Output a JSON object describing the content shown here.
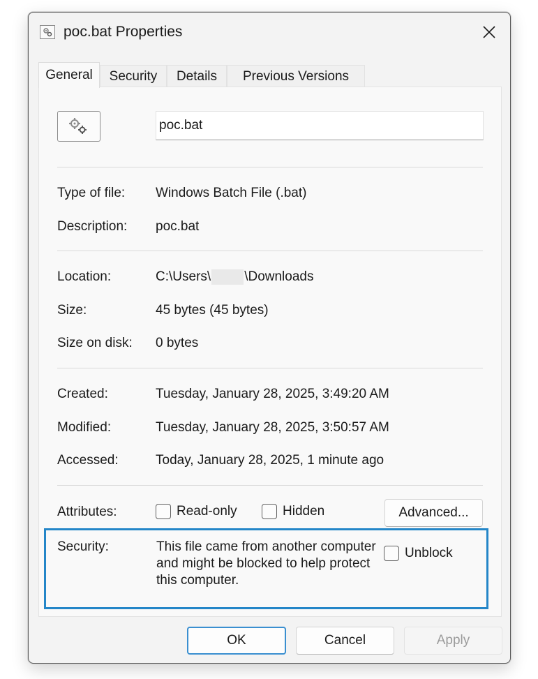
{
  "window": {
    "title": "poc.bat Properties",
    "title_icon": "bat-file-icon",
    "close_icon": "close-icon"
  },
  "tabs": [
    {
      "label": "General",
      "active": true
    },
    {
      "label": "Security",
      "active": false
    },
    {
      "label": "Details",
      "active": false
    },
    {
      "label": "Previous Versions",
      "active": false
    }
  ],
  "general": {
    "file_icon": "gears-icon",
    "file_name": "poc.bat",
    "type_of_file": {
      "label": "Type of file:",
      "value": "Windows Batch File (.bat)"
    },
    "description": {
      "label": "Description:",
      "value": "poc.bat"
    },
    "location": {
      "label": "Location:",
      "value_prefix": "C:\\Users\\",
      "value_suffix": "\\Downloads"
    },
    "size": {
      "label": "Size:",
      "value": "45 bytes (45 bytes)"
    },
    "size_on_disk": {
      "label": "Size on disk:",
      "value": "0 bytes"
    },
    "created": {
      "label": "Created:",
      "value": "Tuesday, January 28, 2025, 3:49:20 AM"
    },
    "modified": {
      "label": "Modified:",
      "value": "Tuesday, January 28, 2025, 3:50:57 AM"
    },
    "accessed": {
      "label": "Accessed:",
      "value": "Today, January 28, 2025, 1 minute ago"
    },
    "attributes": {
      "label": "Attributes:",
      "read_only": {
        "label": "Read-only",
        "checked": false
      },
      "hidden": {
        "label": "Hidden",
        "checked": false
      },
      "advanced_label": "Advanced..."
    },
    "security": {
      "label": "Security:",
      "message": "This file came from another computer and might be blocked to help protect this computer.",
      "unblock": {
        "label": "Unblock",
        "checked": false
      },
      "highlight_color": "#2486c8"
    }
  },
  "buttons": {
    "ok": "OK",
    "cancel": "Cancel",
    "apply": "Apply"
  }
}
